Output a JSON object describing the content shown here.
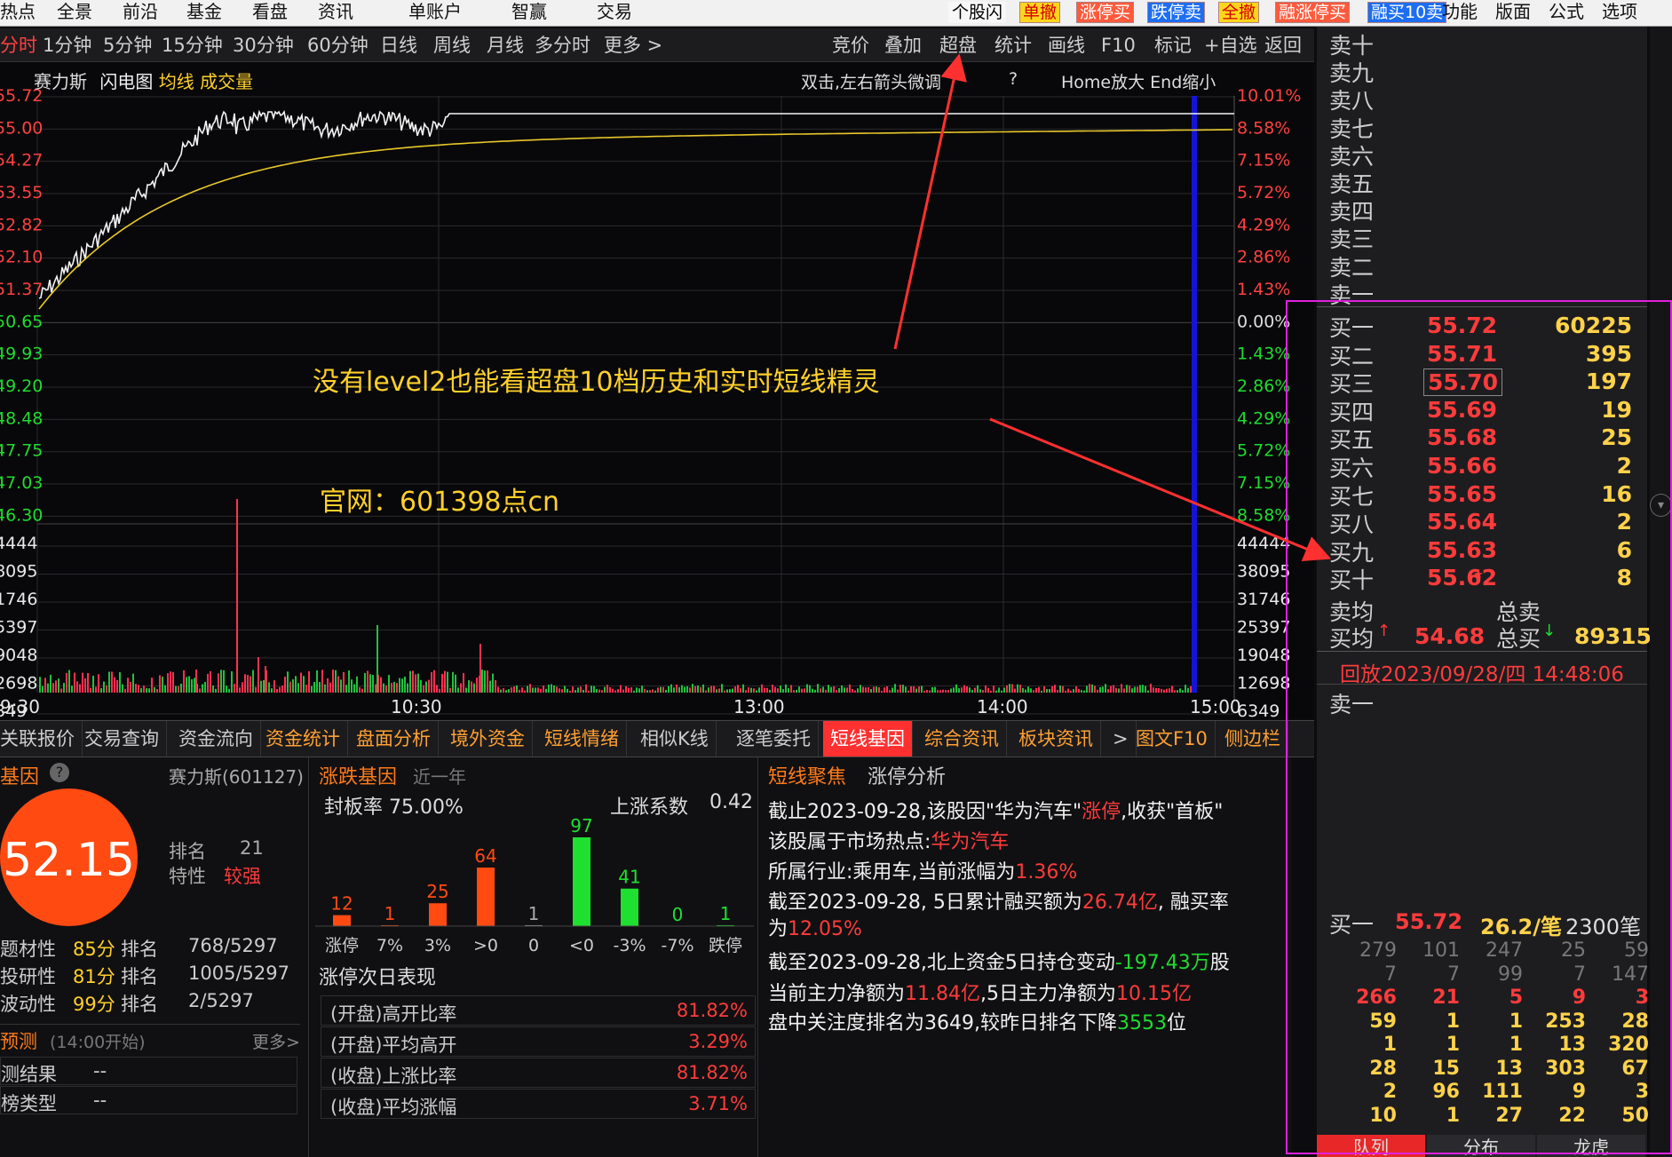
{
  "menu": [
    "热点",
    "全景",
    "前沿",
    "基金",
    "看盘",
    "资讯",
    "单账户",
    "智赢",
    "交易"
  ],
  "quick_buttons": [
    {
      "label": "个股闪",
      "style": "w"
    },
    {
      "label": "单撤",
      "style": "y"
    },
    {
      "label": "涨停买",
      "style": "r"
    },
    {
      "label": "跌停卖",
      "style": "b"
    },
    {
      "label": "全撤",
      "style": "y"
    },
    {
      "label": "融涨停买",
      "style": "r"
    },
    {
      "label": "融买10卖",
      "style": "b"
    }
  ],
  "menu_right": [
    "功能",
    "版面",
    "公式",
    "选项"
  ],
  "periods": [
    "分时",
    "1分钟",
    "5分钟",
    "15分钟",
    "30分钟",
    "60分钟",
    "日线",
    "周线",
    "月线",
    "多分时",
    "更多 >"
  ],
  "tools": [
    "竞价",
    "叠加",
    "超盘",
    "统计",
    "画线",
    "F10",
    "标记",
    "+自选",
    "返回"
  ],
  "chart": {
    "stock_name": "赛力斯",
    "legend": [
      "闪电图",
      "均线",
      "成交量"
    ],
    "hint": "双击,左右箭头微调",
    "help": "?",
    "zoom_hint": "Home放大 End缩小",
    "price_labels": [
      "55.72",
      "55.00",
      "54.27",
      "53.55",
      "52.82",
      "52.10",
      "51.37",
      "50.65",
      "49.93",
      "49.20",
      "48.48",
      "47.75",
      "47.03",
      "46.30"
    ],
    "pct_labels": [
      "10.01%",
      "8.58%",
      "7.15%",
      "5.72%",
      "4.29%",
      "2.86%",
      "1.43%",
      "0.00%",
      "1.43%",
      "2.86%",
      "4.29%",
      "5.72%",
      "7.15%",
      "8.58%"
    ],
    "vol_labels_left": [
      "44444",
      "38095",
      "31746",
      "25397",
      "19048",
      "12698",
      "6349"
    ],
    "vol_labels_right": [
      "44444",
      "38095",
      "31746",
      "25397",
      "19048",
      "12698",
      "6349"
    ],
    "time_labels": [
      "9:30",
      "10:30",
      "13:00",
      "14:00",
      "15:00"
    ],
    "annotation1": "没有level2也能看超盘10档历史和实时短线精灵",
    "annotation2": "官网：601398点cn"
  },
  "bottom_tabs": [
    {
      "label": "关联报价",
      "style": ""
    },
    {
      "label": "交易查询",
      "style": ""
    },
    {
      "label": "资金流向",
      "style": ""
    },
    {
      "label": "资金统计",
      "style": "or"
    },
    {
      "label": "盘面分析",
      "style": "or"
    },
    {
      "label": "境外资金",
      "style": "or"
    },
    {
      "label": "短线情绪",
      "style": "or"
    },
    {
      "label": "相似K线",
      "style": ""
    },
    {
      "label": "逐笔委托",
      "style": ""
    },
    {
      "label": "短线基因",
      "style": "act"
    },
    {
      "label": "综合资讯",
      "style": "or"
    },
    {
      "label": "板块资讯",
      "style": "or"
    },
    {
      "label": ">",
      "style": ""
    },
    {
      "label": "图文F10",
      "style": "or"
    },
    {
      "label": "侧边栏",
      "style": "or"
    }
  ],
  "gene": {
    "title": "基因",
    "stock": "赛力斯(601127)",
    "score": "52.15",
    "rank_label": "排名",
    "rank_value": "21",
    "trait_label": "特性",
    "trait_value": "较强",
    "rows": [
      {
        "label": "题材性",
        "score": "85分",
        "rank_label": "排名",
        "rank": "768/5297"
      },
      {
        "label": "投研性",
        "score": "81分",
        "rank_label": "排名",
        "rank": "1005/5297"
      },
      {
        "label": "波动性",
        "score": "99分",
        "rank_label": "排名",
        "rank": "2/5297"
      }
    ],
    "predict_title": "预测",
    "predict_sub": "(14:00开始)",
    "more": "更多>",
    "predict_rows": [
      {
        "label": "测结果",
        "value": "--"
      },
      {
        "label": "榜类型",
        "value": "--"
      }
    ]
  },
  "zhangdie": {
    "title": "涨跌基因",
    "sub": "近一年",
    "seal_rate": "封板率 75.00%",
    "rise_coef_label": "上涨系数",
    "rise_coef": "0.42",
    "next_day_title": "涨停次日表现",
    "next_day": [
      {
        "label": "(开盘)高开比率",
        "value": "81.82%"
      },
      {
        "label": "(开盘)平均高开",
        "value": "3.29%"
      },
      {
        "label": "(收盘)上涨比率",
        "value": "81.82%"
      },
      {
        "label": "(收盘)平均涨幅",
        "value": "3.71%"
      }
    ]
  },
  "chart_data": {
    "type": "bar",
    "categories": [
      "涨停",
      "7%",
      "3%",
      ">0",
      "0",
      "<0",
      "-3%",
      "-7%",
      "跌停"
    ],
    "values": [
      12,
      1,
      25,
      64,
      1,
      97,
      41,
      0,
      1
    ],
    "colors": [
      "#ff4a12",
      "#ff4a12",
      "#ff4a12",
      "#ff4a12",
      "#aaaaaa",
      "#1fe030",
      "#1fe030",
      "#1fe030",
      "#1fe030"
    ]
  },
  "focus": {
    "title": "短线聚焦",
    "title2": "涨停分析",
    "lines": [
      [
        {
          "t": "截止2023-09-28,该股因\"华为汽车\"",
          "c": "wht"
        },
        {
          "t": "涨停",
          "c": "red"
        },
        {
          "t": ",收获\"首板\"",
          "c": "wht"
        }
      ],
      [
        {
          "t": "该股属于市场热点:",
          "c": "wht"
        },
        {
          "t": "华为汽车",
          "c": "red"
        }
      ],
      [
        {
          "t": "所属行业:乘用车,当前涨幅为",
          "c": "wht"
        },
        {
          "t": "1.36%",
          "c": "red"
        }
      ],
      [
        {
          "t": "截至2023-09-28, 5日累计融买额为",
          "c": "wht"
        },
        {
          "t": "26.74亿",
          "c": "red"
        },
        {
          "t": ", 融买率",
          "c": "wht"
        }
      ],
      [
        {
          "t": "为",
          "c": "wht"
        },
        {
          "t": "12.05%",
          "c": "red"
        }
      ],
      [
        {
          "t": "截至2023-09-28,北上资金5日持仓变动",
          "c": "wht"
        },
        {
          "t": "-197.43万",
          "c": "grn"
        },
        {
          "t": "股",
          "c": "wht"
        }
      ],
      [
        {
          "t": "当前主力净额为",
          "c": "wht"
        },
        {
          "t": "11.84亿",
          "c": "red"
        },
        {
          "t": ",5日主力净额为",
          "c": "wht"
        },
        {
          "t": "10.15亿",
          "c": "red"
        }
      ],
      [
        {
          "t": "盘中关注度排名为3649,较昨日排名下降",
          "c": "wht"
        },
        {
          "t": "3553",
          "c": "grn"
        },
        {
          "t": "位",
          "c": "wht"
        }
      ]
    ]
  },
  "orderbook": {
    "sells": [
      "卖十",
      "卖九",
      "卖八",
      "卖七",
      "卖六",
      "卖五",
      "卖四",
      "卖三",
      "卖二",
      "卖一"
    ],
    "buys": [
      {
        "label": "买一",
        "price": "55.72",
        "vol": "60225"
      },
      {
        "label": "买二",
        "price": "55.71",
        "vol": "395"
      },
      {
        "label": "买三",
        "price": "55.70",
        "vol": "197"
      },
      {
        "label": "买四",
        "price": "55.69",
        "vol": "19"
      },
      {
        "label": "买五",
        "price": "55.68",
        "vol": "25"
      },
      {
        "label": "买六",
        "price": "55.66",
        "vol": "2"
      },
      {
        "label": "买七",
        "price": "55.65",
        "vol": "16"
      },
      {
        "label": "买八",
        "price": "55.64",
        "vol": "2"
      },
      {
        "label": "买九",
        "price": "55.63",
        "vol": "6"
      },
      {
        "label": "买十",
        "price": "55.62",
        "vol": "8"
      }
    ],
    "sell_avg_label": "卖均",
    "total_sell_label": "总卖",
    "buy_avg_label": "买均",
    "buy_avg": "54.68",
    "total_buy_label": "总买",
    "total_buy": "89315",
    "replay": "回放2023/09/28/四 14:48:06",
    "queue_sell_label": "卖一",
    "queue_buy": {
      "label": "买一",
      "price": "55.72",
      "per": "26.2/笔",
      "count": "2300笔"
    },
    "queue_grid": [
      [
        "279",
        "101",
        "247",
        "25",
        "59"
      ],
      [
        "7",
        "7",
        "99",
        "7",
        "147"
      ],
      [
        "266",
        "21",
        "5",
        "9",
        "3"
      ],
      [
        "59",
        "1",
        "1",
        "253",
        "28"
      ],
      [
        "1",
        "1",
        "1",
        "13",
        "320"
      ],
      [
        "28",
        "15",
        "13",
        "303",
        "67"
      ],
      [
        "2",
        "96",
        "111",
        "9",
        "3"
      ],
      [
        "10",
        "1",
        "27",
        "22",
        "50"
      ]
    ],
    "bottom_tabs": [
      "队列",
      "分布",
      "龙虎"
    ]
  }
}
